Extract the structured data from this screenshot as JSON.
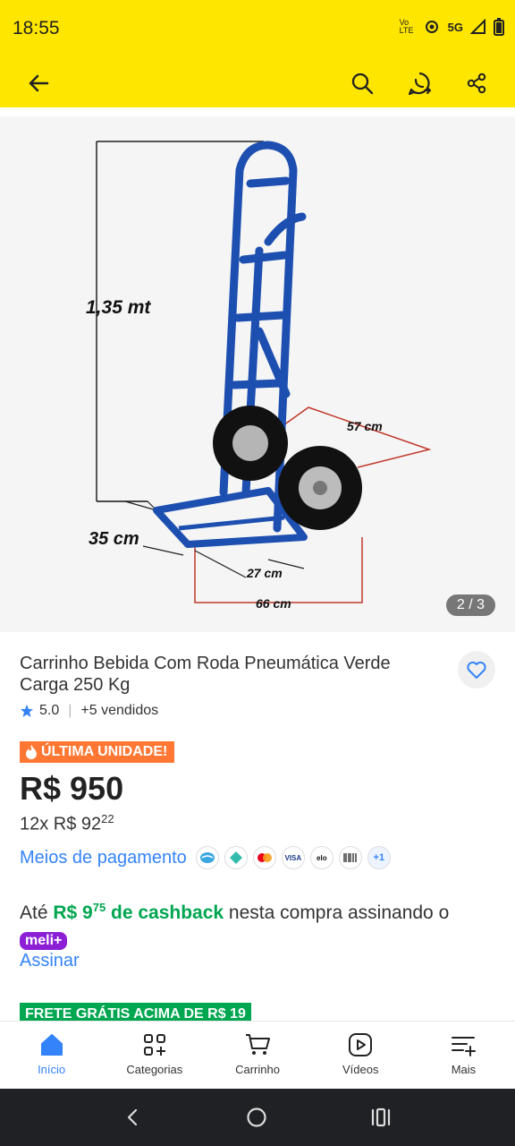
{
  "status_bar": {
    "time": "18:55",
    "network": "5G",
    "volte": "Vo LTE"
  },
  "product": {
    "image_counter": "2 / 3",
    "dimensions": {
      "height": "1,35 mt",
      "width_top": "57 cm",
      "depth": "35 cm",
      "base_inner": "27 cm",
      "base_outer": "66 cm"
    },
    "title": "Carrinho Bebida Com Roda Pneumática Verde Carga 250 Kg",
    "rating": "5.0",
    "sold": "+5 vendidos",
    "badge": "ÚLTIMA UNIDADE!",
    "price": "R$ 950",
    "installments_prefix": "12x R$ 92",
    "installments_cents": "22",
    "payment_link": "Meios de pagamento",
    "payment_more": "+1",
    "cashback_prefix": "Até ",
    "cashback_amount": "R$ 9",
    "cashback_cents": "75",
    "cashback_mid": " de cashback",
    "cashback_suffix": " nesta compra assinando o ",
    "meli_badge": "meli+",
    "subscribe": "Assinar",
    "frete": "FRETE GRÁTIS ACIMA DE R$ 19"
  },
  "bottom_nav": {
    "inicio": "Início",
    "categorias": "Categorias",
    "carrinho": "Carrinho",
    "videos": "Vídeos",
    "mais": "Mais"
  },
  "colors": {
    "brand_yellow": "#ffe600",
    "link_blue": "#3483fa",
    "green": "#00a650",
    "badge_orange": "#ff7733",
    "meli_purple": "#8c1fd6"
  }
}
